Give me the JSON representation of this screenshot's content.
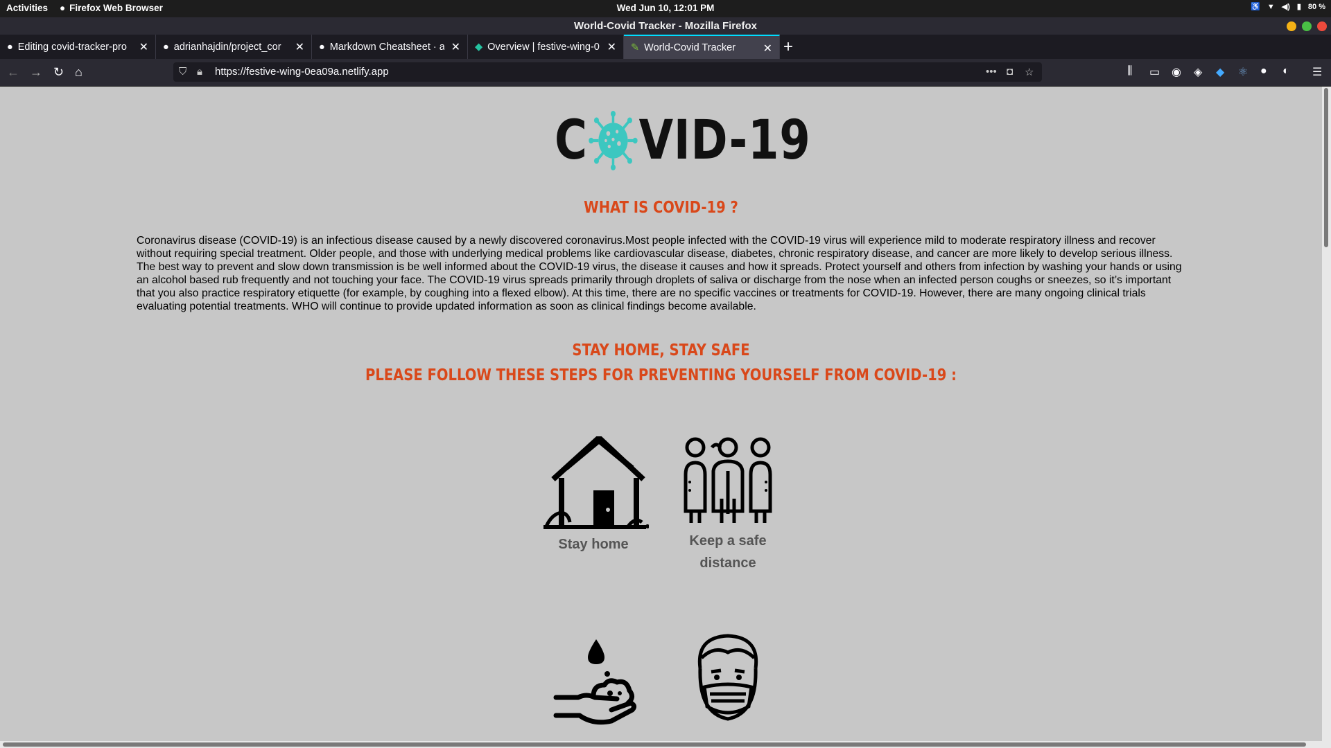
{
  "system": {
    "activities": "Activities",
    "app_name": "Firefox Web Browser",
    "clock": "Wed Jun 10, 12:01 PM",
    "battery": "80 %"
  },
  "window": {
    "title": "World-Covid Tracker - Mozilla Firefox"
  },
  "tabs": [
    {
      "label": "Editing covid-tracker-pro",
      "icon": "github-icon"
    },
    {
      "label": "adrianhajdin/project_cor",
      "icon": "github-icon"
    },
    {
      "label": "Markdown Cheatsheet · a",
      "icon": "github-icon"
    },
    {
      "label": "Overview | festive-wing-0",
      "icon": "netlify-icon"
    },
    {
      "label": "World-Covid Tracker",
      "icon": "site-icon",
      "active": true
    }
  ],
  "nav": {
    "url": "https://festive-wing-0ea09a.netlify.app"
  },
  "page": {
    "logo_c": "C",
    "logo_rest": "VID-19",
    "what_title": "WHAT IS COVID-19 ?",
    "description": "Coronavirus disease (COVID-19) is an infectious disease caused by a newly discovered coronavirus.Most people infected with the COVID-19 virus will experience mild to moderate respiratory illness and recover without requiring special treatment. Older people, and those with underlying medical problems like cardiovascular disease, diabetes, chronic respiratory disease, and cancer are more likely to develop serious illness. The best way to prevent and slow down transmission is be well informed about the COVID-19 virus, the disease it causes and how it spreads. Protect yourself and others from infection by washing your hands or using an alcohol based rub frequently and not touching your face. The COVID-19 virus spreads primarily through droplets of saliva or discharge from the nose when an infected person coughs or sneezes, so it’s important that you also practice respiratory etiquette (for example, by coughing into a flexed elbow). At this time, there are no specific vaccines or treatments for COVID-19. However, there are many ongoing clinical trials evaluating potential treatments. WHO will continue to provide updated information as soon as clinical findings become available.",
    "stay_title": "STAY HOME, STAY SAFE",
    "steps_title": "PLEASE FOLLOW THESE STEPS FOR PREVENTING YOURSELF FROM COVID-19 :",
    "steps": [
      {
        "label": "Stay home",
        "icon": "house-icon"
      },
      {
        "label": "Keep a safe distance",
        "icon": "people-distance-icon"
      },
      {
        "label": "",
        "icon": "hand-wash-icon"
      },
      {
        "label": "",
        "icon": "face-mask-icon"
      }
    ]
  },
  "colors": {
    "heading": "#d9481a",
    "virus": "#3cc7c0",
    "page_bg": "#c7c7c7"
  }
}
